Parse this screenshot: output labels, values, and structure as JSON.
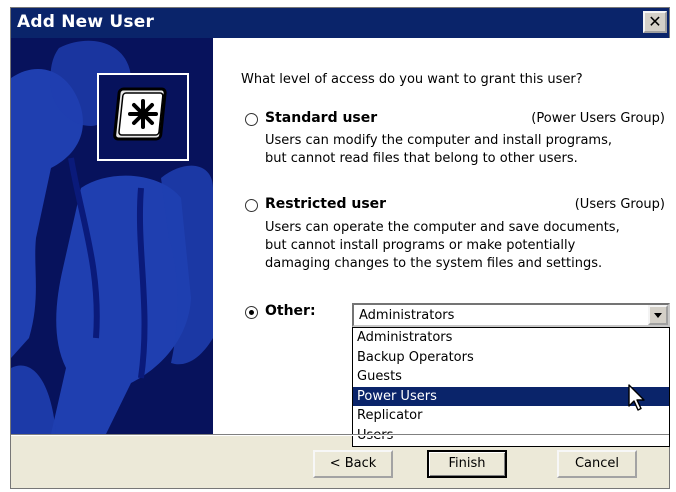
{
  "window": {
    "title": "Add New User",
    "close_glyph": "✕"
  },
  "wizard": {
    "question": "What level of access do you want to grant this user?",
    "options": [
      {
        "label": "Standard user",
        "group": "(Power Users Group)",
        "description": [
          "Users can modify the computer and install programs,",
          "but cannot read files that belong to other users."
        ],
        "selected": false
      },
      {
        "label": "Restricted user",
        "group": "(Users Group)",
        "description": [
          "Users can operate the computer and save documents,",
          "but cannot install programs or make potentially",
          "damaging changes to the system files and settings."
        ],
        "selected": false
      },
      {
        "label": "Other:",
        "selected": true
      }
    ],
    "other_combo": {
      "value": "Administrators",
      "dropdown_open": true,
      "options": [
        "Administrators",
        "Backup Operators",
        "Guests",
        "Power Users",
        "Replicator",
        "Users"
      ],
      "highlighted": "Power Users"
    }
  },
  "buttons": {
    "back": "< Back",
    "finish": "Finish",
    "cancel": "Cancel"
  },
  "colors": {
    "titlebar": "#0a246a",
    "side_panel": "#07125c",
    "side_shapes": "#1f3fb0",
    "selection": "#0a246a"
  },
  "icons": [
    "users-wizard-logo-icon",
    "close-icon",
    "chevron-down-icon",
    "mouse-cursor-icon"
  ]
}
